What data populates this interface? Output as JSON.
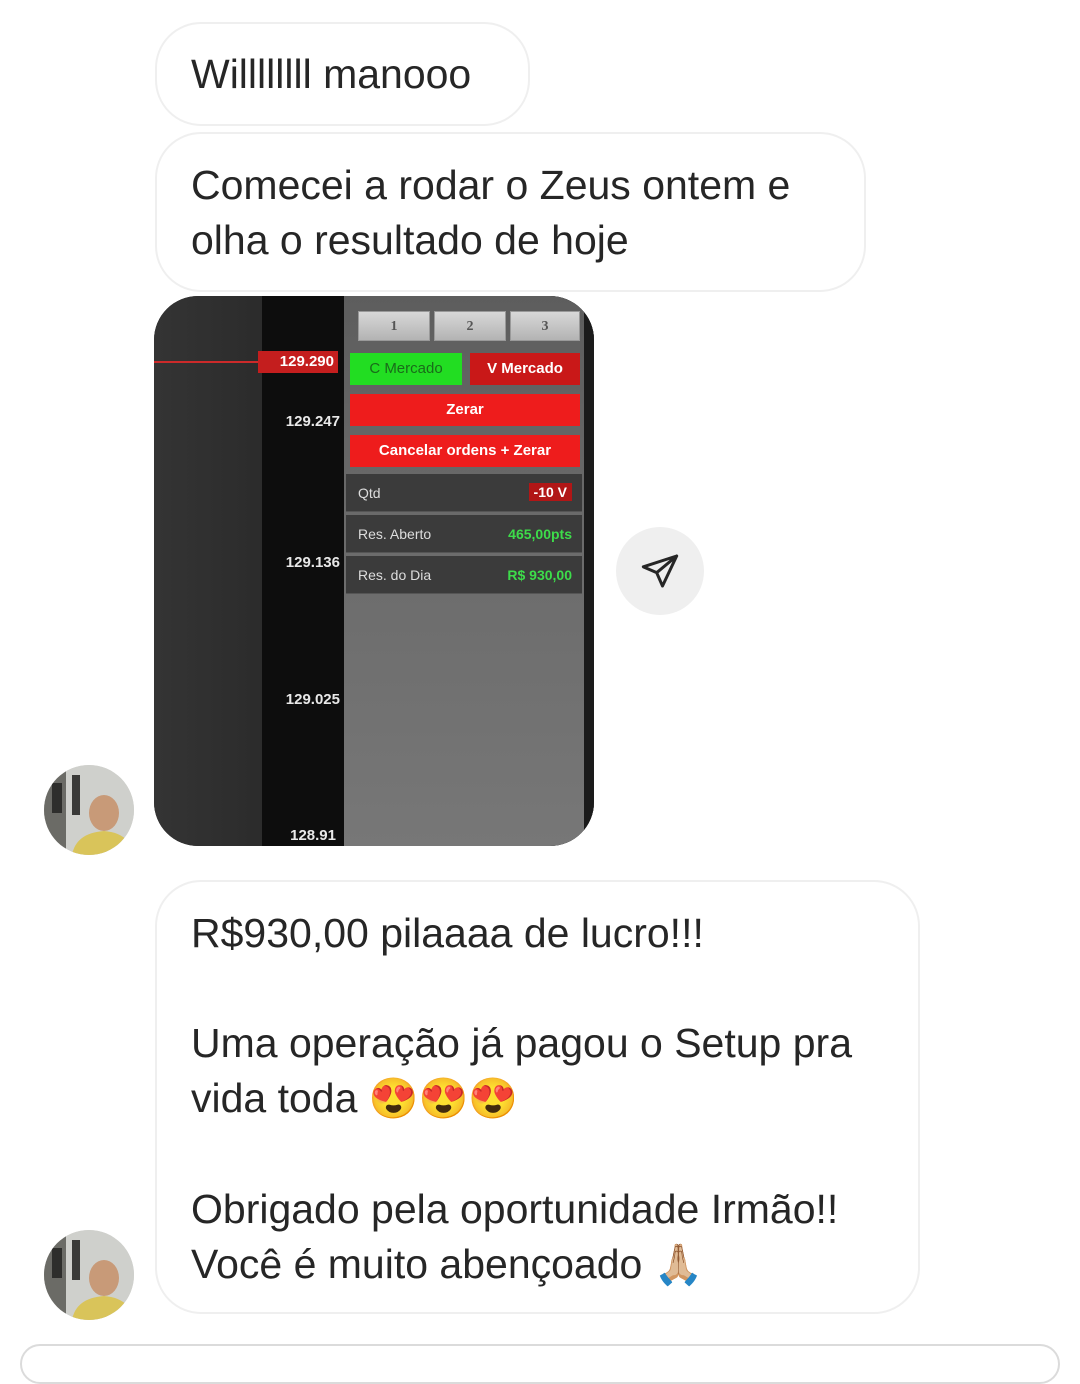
{
  "messages": {
    "m1": "Willllllll manooo",
    "m2": "Comecei a rodar o Zeus ontem e olha o resultado de hoje",
    "m3": {
      "p1": "R$930,00 pilaaaa de lucro!!!",
      "p2": "Uma operação já pagou o Setup pra vida toda",
      "p2_emoji": "😍😍😍",
      "p3_l1": "Obrigado pela oportunidade Irmão!!",
      "p3_l2": "Você é muito abençoado",
      "p3_emoji": "🙏🏼"
    }
  },
  "screenshot": {
    "prices": [
      "129.290",
      "129.247",
      "129.136",
      "129.025",
      "128.91"
    ],
    "tabs": [
      "1",
      "2",
      "3"
    ],
    "buy_label": "C Mercado",
    "sell_label": "V Mercado",
    "zerar_label": "Zerar",
    "cancel_label": "Cancelar ordens + Zerar",
    "qtd_label": "Qtd",
    "qtd_value": "-10 V",
    "res_aberto_label": "Res. Aberto",
    "res_aberto_value": "465,00pts",
    "res_dia_label": "Res. do Dia",
    "res_dia_value": "R$ 930,00"
  },
  "icons": {
    "share": "paper-plane-icon",
    "avatar": "user-avatar"
  },
  "colors": {
    "bubble_border": "#efefef",
    "text": "#262626",
    "buy_green": "#22dd22",
    "sell_red": "#c91818",
    "profit_green": "#3ddc4a"
  }
}
